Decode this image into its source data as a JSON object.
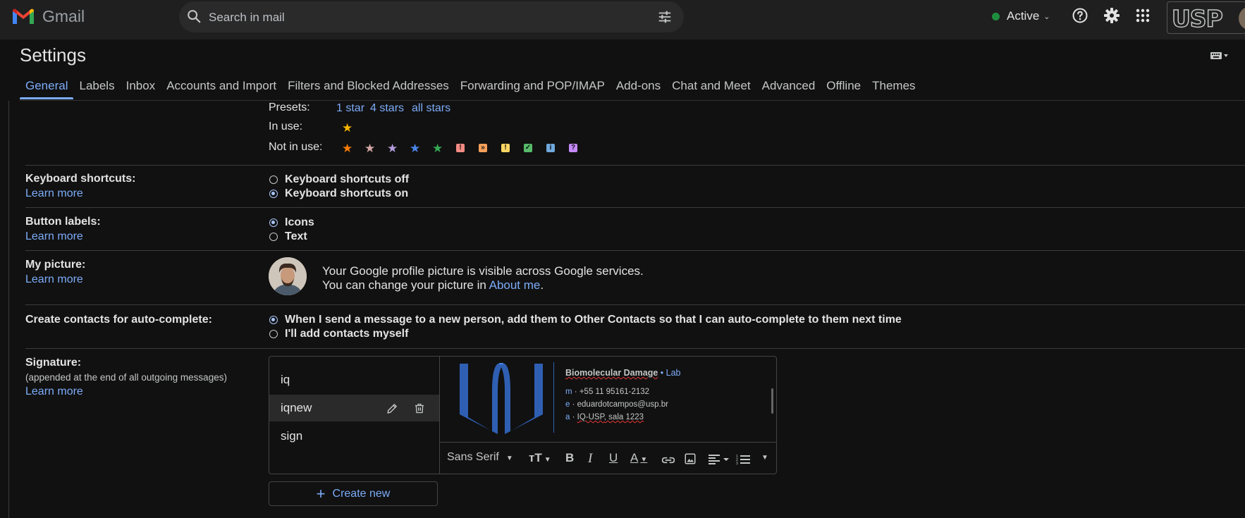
{
  "app": {
    "name": "Gmail"
  },
  "search": {
    "placeholder": "Search in mail"
  },
  "status": {
    "label": "Active",
    "color": "#1e8e3e"
  },
  "account": {
    "org_logo": "USP"
  },
  "settings": {
    "title": "Settings",
    "tabs": [
      {
        "label": "General",
        "active": true
      },
      {
        "label": "Labels"
      },
      {
        "label": "Inbox"
      },
      {
        "label": "Accounts and Import"
      },
      {
        "label": "Filters and Blocked Addresses"
      },
      {
        "label": "Forwarding and POP/IMAP"
      },
      {
        "label": "Add-ons"
      },
      {
        "label": "Chat and Meet"
      },
      {
        "label": "Advanced"
      },
      {
        "label": "Offline"
      },
      {
        "label": "Themes"
      }
    ]
  },
  "stars": {
    "presets_label": "Presets:",
    "presets": [
      "1 star",
      "4 stars",
      "all stars"
    ],
    "in_use_label": "In use:",
    "in_use": [
      {
        "icon": "yellow-star-icon",
        "color": "#f4b400"
      }
    ],
    "not_in_use_label": "Not in use:",
    "not_in_use": [
      {
        "icon": "orange-star-icon",
        "color": "#f57c00",
        "glyph": "★"
      },
      {
        "icon": "red-star-icon",
        "color": "#d4a5a5",
        "glyph": "★"
      },
      {
        "icon": "purple-star-icon",
        "color": "#b39ddb",
        "glyph": "★"
      },
      {
        "icon": "blue-star-icon",
        "color": "#4a86e8",
        "glyph": "★"
      },
      {
        "icon": "green-star-icon",
        "color": "#34a853",
        "glyph": "★"
      },
      {
        "icon": "red-bang-icon",
        "color": "#f28b82",
        "glyph": "!"
      },
      {
        "icon": "orange-guillemet-icon",
        "color": "#f6a05a",
        "glyph": "»"
      },
      {
        "icon": "yellow-bang-icon",
        "color": "#fdd663",
        "glyph": "!"
      },
      {
        "icon": "green-check-icon",
        "color": "#57bb6a",
        "glyph": "✓"
      },
      {
        "icon": "blue-info-icon",
        "color": "#6fa8dc",
        "glyph": "i"
      },
      {
        "icon": "purple-question-icon",
        "color": "#c58af9",
        "glyph": "?"
      }
    ]
  },
  "keyboard": {
    "label": "Keyboard shortcuts:",
    "learn_more": "Learn more",
    "options": [
      {
        "label": "Keyboard shortcuts off",
        "selected": false
      },
      {
        "label": "Keyboard shortcuts on",
        "selected": true
      }
    ]
  },
  "button_labels": {
    "label": "Button labels:",
    "learn_more": "Learn more",
    "options": [
      {
        "label": "Icons",
        "selected": true
      },
      {
        "label": "Text",
        "selected": false
      }
    ]
  },
  "picture": {
    "label": "My picture:",
    "learn_more": "Learn more",
    "line1": "Your Google profile picture is visible across Google services.",
    "line2_prefix": "You can change your picture in ",
    "line2_link": "About me",
    "line2_suffix": "."
  },
  "contacts": {
    "label": "Create contacts for auto-complete:",
    "options": [
      {
        "label": "When I send a message to a new person, add them to Other Contacts so that I can auto-complete to them next time",
        "selected": true
      },
      {
        "label": "I'll add contacts myself",
        "selected": false
      }
    ]
  },
  "signature": {
    "label": "Signature:",
    "sub": "(appended at the end of all outgoing messages)",
    "learn_more": "Learn more",
    "items": [
      "iq",
      "iqnew",
      "sign"
    ],
    "selected": "iqnew",
    "preview": {
      "title_main": "Biomolecular Damage",
      "title_sep": " • ",
      "title_lab": "Lab",
      "m_key": "m",
      "m_val": "+55 11 95161-2132",
      "e_key": "e",
      "e_val": "eduardotcampos@usp.br",
      "a_key": "a",
      "a_val_1": "IQ-USP",
      "a_val_2": ", sala 1223",
      "dot": " · "
    },
    "toolbar": {
      "font": "Sans Serif"
    },
    "create_new": "Create new"
  }
}
